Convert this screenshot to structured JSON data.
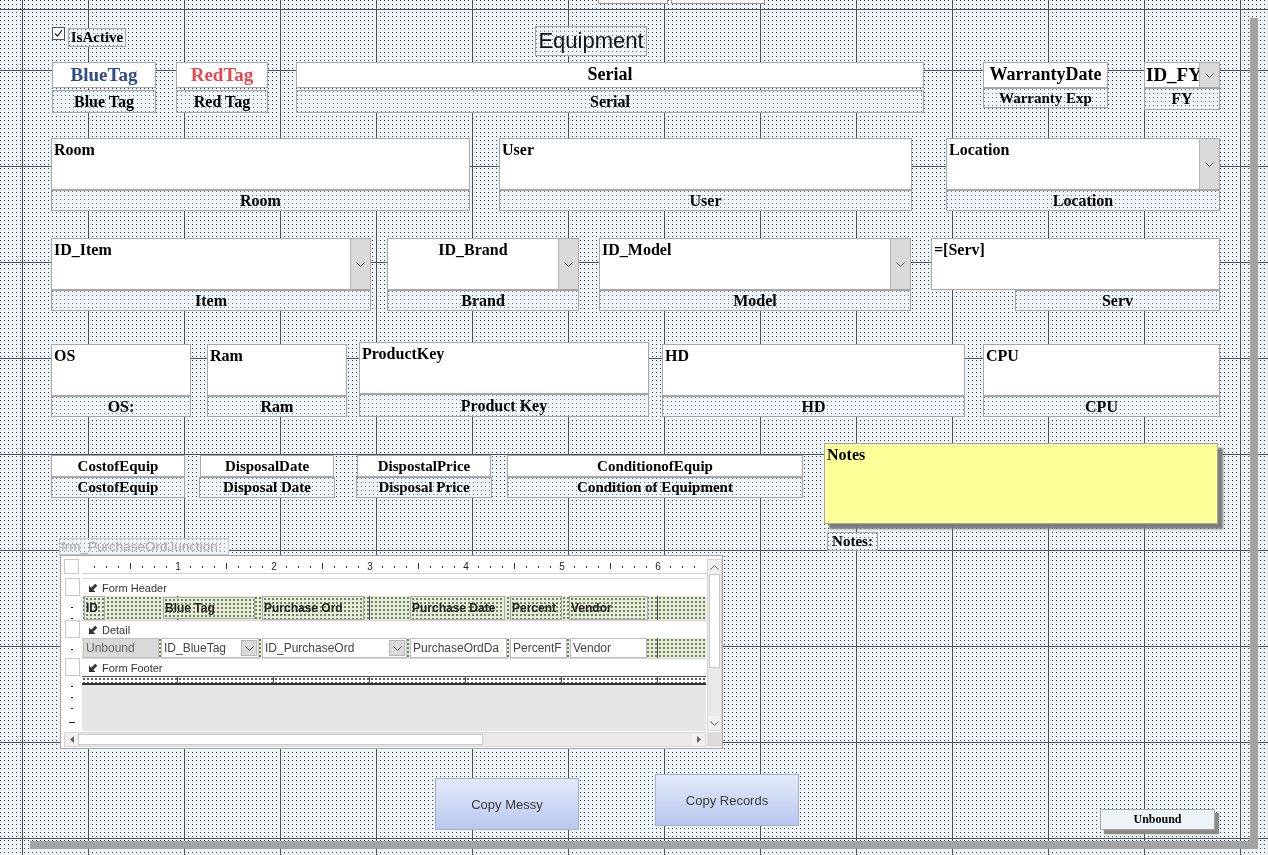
{
  "form": {
    "title": "Equipment"
  },
  "is_active": {
    "label": "IsActive",
    "checked": true
  },
  "fields": [
    {
      "kind": "textbox",
      "source": "BlueTag",
      "label": "Blue Tag",
      "color": "#2e4c87"
    },
    {
      "kind": "textbox",
      "source": "RedTag",
      "label": "Red Tag",
      "color": "#e8474d"
    },
    {
      "kind": "textbox",
      "source": "Serial",
      "label": "Serial"
    },
    {
      "kind": "textbox",
      "source": "WarrantyDate",
      "label": "Warranty Exp"
    },
    {
      "kind": "combobox",
      "source": "ID_FY",
      "label": "FY"
    },
    {
      "kind": "textbox",
      "source": "Room",
      "label": "Room"
    },
    {
      "kind": "textbox",
      "source": "User",
      "label": "User"
    },
    {
      "kind": "combobox",
      "source": "Location",
      "label": "Location"
    },
    {
      "kind": "combobox",
      "source": "ID_Item",
      "label": "Item"
    },
    {
      "kind": "combobox",
      "source": "ID_Brand",
      "label": "Brand"
    },
    {
      "kind": "combobox",
      "source": "ID_Model",
      "label": "Model"
    },
    {
      "kind": "textbox",
      "source": "=[Serv]",
      "label": "Serv"
    },
    {
      "kind": "textbox",
      "source": "OS",
      "label": "OS:"
    },
    {
      "kind": "textbox",
      "source": "Ram",
      "label": "Ram"
    },
    {
      "kind": "textbox",
      "source": "ProductKey",
      "label": "Product Key"
    },
    {
      "kind": "textbox",
      "source": "HD",
      "label": "HD"
    },
    {
      "kind": "textbox",
      "source": "CPU",
      "label": "CPU"
    },
    {
      "kind": "textbox",
      "source": "CostofEquip",
      "label": "CostofEquip"
    },
    {
      "kind": "textbox",
      "source": "DisposalDate",
      "label": "Disposal Date"
    },
    {
      "kind": "textbox",
      "source": "DispostalPrice",
      "label": "Disposal Price"
    },
    {
      "kind": "textbox",
      "source": "ConditionofEquip",
      "label": "Condition of Equipment"
    },
    {
      "kind": "note",
      "source": "Notes",
      "label": "Notes:",
      "color": "#ffff99"
    },
    {
      "kind": "shadowed",
      "source": "Unbound"
    }
  ],
  "subform": {
    "label": "frm_PurchaseOrdJunction:",
    "ruler": [
      "1",
      "2",
      "3",
      "4",
      "5",
      "6"
    ],
    "sections": [
      {
        "kind": "header",
        "title": "Form Header",
        "controls": [
          {
            "kind": "label",
            "text": "ID"
          },
          {
            "kind": "label",
            "text": "Blue Tag"
          },
          {
            "kind": "label",
            "text": "Purchase Ord"
          },
          {
            "kind": "label",
            "text": "Purchase Date"
          },
          {
            "kind": "label",
            "text": "Percent"
          },
          {
            "kind": "label",
            "text": "Vendor"
          }
        ]
      },
      {
        "kind": "detail",
        "title": "Detail",
        "controls": [
          {
            "kind": "unbound",
            "text": "Unbound"
          },
          {
            "kind": "combobox",
            "text": "ID_BlueTag"
          },
          {
            "kind": "combobox",
            "text": "ID_PurchaseOrd"
          },
          {
            "kind": "textbox",
            "text": "PurchaseOrdDa"
          },
          {
            "kind": "textbox",
            "text": "PercentF"
          },
          {
            "kind": "textbox",
            "text": "Vendor"
          }
        ]
      },
      {
        "kind": "footer",
        "title": "Form Footer"
      }
    ]
  },
  "buttons": [
    {
      "text": "Copy Messy"
    },
    {
      "text": "Copy Records"
    }
  ]
}
